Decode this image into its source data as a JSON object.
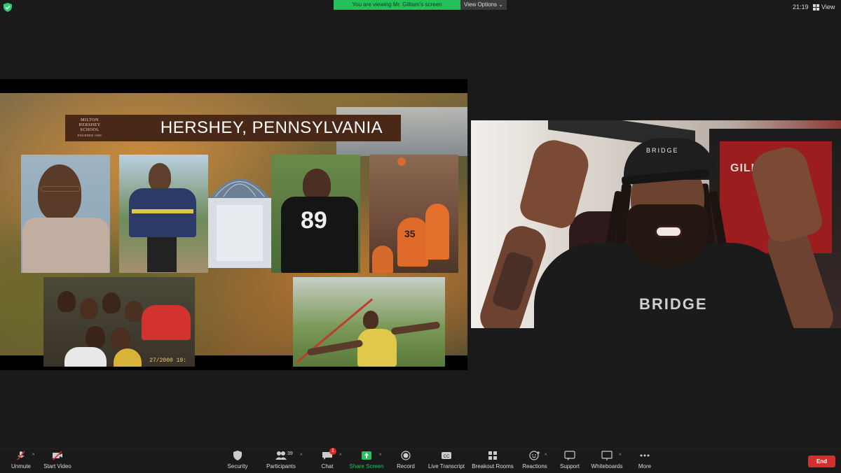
{
  "topbar": {
    "viewing_banner": "You are viewing Mr. Gilliam's screen",
    "view_options": "View Options",
    "clock": "21:19",
    "view_label": "View"
  },
  "shared_slide": {
    "school_logo_lines": [
      "MILTON",
      "HERSHEY",
      "SCHOOL"
    ],
    "school_logo_small": "FOUNDED 1909",
    "title": "HERSHEY, PENNSYLVANIA",
    "photo_date_stamp": "27/2000 19:"
  },
  "camera": {
    "cap_text": "BRIDGE",
    "wall_jersey_name": "GILLIAM",
    "shirt_text": "BRIDGE"
  },
  "toolbar": {
    "unmute": "Unmute",
    "start_video": "Start Video",
    "security": "Security",
    "participants": "Participants",
    "participants_count": "39",
    "chat": "Chat",
    "chat_badge": "1",
    "share_screen": "Share Screen",
    "record": "Record",
    "live_transcript": "Live Transcript",
    "breakout_rooms": "Breakout Rooms",
    "reactions": "Reactions",
    "support": "Support",
    "whiteboards": "Whiteboards",
    "more": "More",
    "end": "End"
  },
  "colors": {
    "banner_green": "#24c15a",
    "end_red": "#d32f2f",
    "share_green": "#23c35d"
  }
}
